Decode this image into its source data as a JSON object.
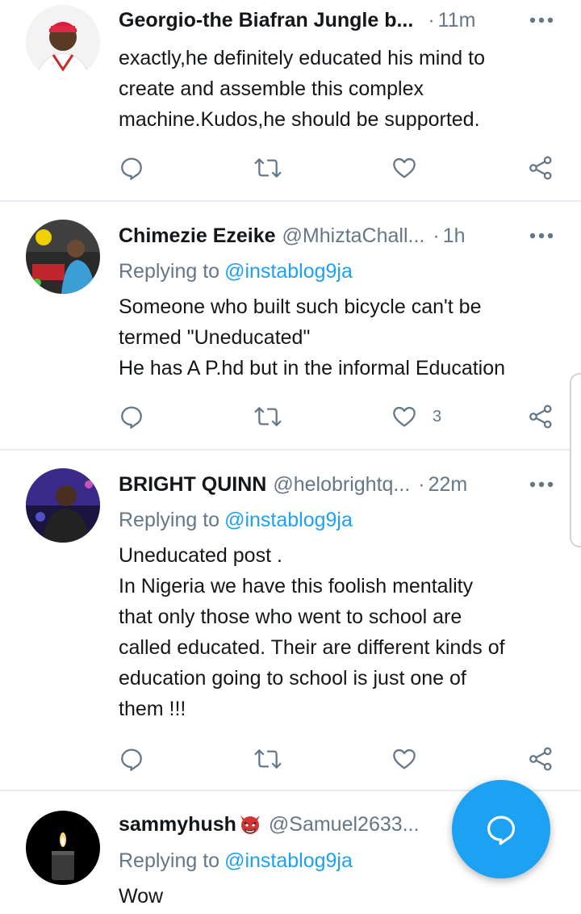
{
  "tweets": [
    {
      "name": "Georgio-the Biafran Jungle b...",
      "handle": "",
      "separator": "·",
      "time": "11m",
      "replying_label": "",
      "replying_to": "",
      "lines": [
        "exactly,he definitely educated his mind to",
        "create and assemble this complex",
        "machine.Kudos,he should be supported."
      ],
      "like_count": ""
    },
    {
      "name": "Chimezie Ezeike",
      "handle": "@MhiztaChall...",
      "separator": "·",
      "time": "1h",
      "replying_label": "Replying to",
      "replying_to": "@instablog9ja",
      "lines": [
        "Someone who built such bicycle can't be",
        "termed \"Uneducated\"",
        "He has A P.hd but in the informal Education"
      ],
      "like_count": "3"
    },
    {
      "name": "BRIGHT QUINN",
      "handle": "@helobrightq...",
      "separator": "·",
      "time": "22m",
      "replying_label": "Replying to",
      "replying_to": "@instablog9ja",
      "lines": [
        "Uneducated post .",
        "In Nigeria we have this foolish mentality",
        "that only those who went to school are",
        "called educated. Their are different kinds of",
        "education going to school is just one of",
        "them !!!"
      ],
      "like_count": ""
    },
    {
      "name": "sammyhush",
      "handle": "@Samuel2633...",
      "separator": "",
      "time": "",
      "replying_label": "Replying to",
      "replying_to": "@instablog9ja",
      "lines": [
        "Wow"
      ],
      "like_count": ""
    }
  ],
  "icons": {
    "reply": "reply-icon",
    "retweet": "retweet-icon",
    "like": "heart-icon",
    "share": "share-icon",
    "more": "more-icon",
    "compose": "compose-reply-icon",
    "emoji": "ogre-emoji-icon"
  },
  "colors": {
    "accent": "#1da1f2",
    "text": "#14171a",
    "secondary": "#657786",
    "divider": "#e6ecf0"
  }
}
